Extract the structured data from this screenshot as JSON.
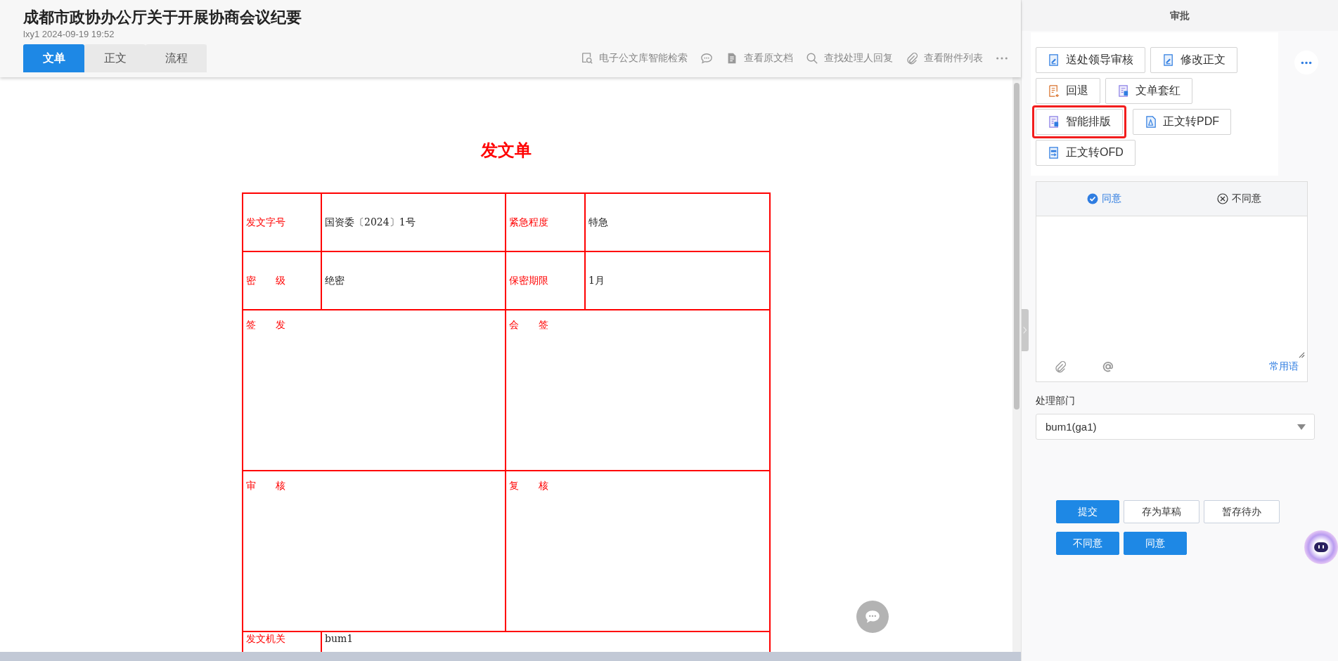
{
  "header": {
    "title": "成都市政协办公厅关于开展协商会议纪要",
    "subtitle": "lxy1 2024-09-19 19:52",
    "tabs": [
      {
        "label": "文单",
        "selected": true
      },
      {
        "label": "正文",
        "selected": false
      },
      {
        "label": "流程",
        "selected": false
      }
    ],
    "toolbar": [
      {
        "kind": "doc-search",
        "label": "电子公文库智能检索"
      },
      {
        "kind": "comment"
      },
      {
        "kind": "document",
        "label": "查看原文档"
      },
      {
        "kind": "search",
        "label": "查找处理人回复"
      },
      {
        "kind": "attach",
        "label": "查看附件列表"
      },
      {
        "kind": "more"
      }
    ]
  },
  "document": {
    "title": "发文单",
    "rows": [
      {
        "kind": "fields",
        "cells": [
          {
            "label": "发文字号",
            "value": "国资委〔2024〕1号"
          },
          {
            "label": "紧急程度",
            "value": "特急"
          }
        ]
      },
      {
        "kind": "fields",
        "cells": [
          {
            "label": "密　　级",
            "value": "绝密"
          },
          {
            "label": "保密期限",
            "value": "1月"
          }
        ]
      },
      {
        "kind": "sign",
        "cells": [
          {
            "label": "签　　发"
          },
          {
            "label": "会　　签"
          }
        ]
      },
      {
        "kind": "sign",
        "cells": [
          {
            "label": "审　　核"
          },
          {
            "label": "复　　核"
          }
        ]
      },
      {
        "kind": "wide",
        "cells": [
          {
            "label": "发文机关",
            "value": "bum1"
          }
        ]
      }
    ]
  },
  "panel": {
    "title": "审批",
    "actions": [
      {
        "kind": "edit",
        "label": "送处领导审核",
        "highlighted": false
      },
      {
        "kind": "edit",
        "label": "修改正文",
        "highlighted": false
      },
      {
        "kind": "return",
        "label": "回退",
        "highlighted": false
      },
      {
        "kind": "layout",
        "label": "文单套红",
        "highlighted": false
      },
      {
        "kind": "layout",
        "label": "智能排版",
        "highlighted": true
      },
      {
        "kind": "pdf",
        "label": "正文转PDF",
        "highlighted": false
      },
      {
        "kind": "ofd",
        "label": "正文转OFD",
        "highlighted": false
      }
    ],
    "opinion": {
      "options": [
        {
          "kind": "agree",
          "label": "同意",
          "selected": true
        },
        {
          "kind": "disagree",
          "label": "不同意",
          "selected": false
        }
      ],
      "phrases": "常用语"
    },
    "department": {
      "label": "处理部门",
      "value": "bum1(ga1)"
    },
    "buttons": [
      [
        {
          "label": "提交",
          "primary": true
        },
        {
          "label": "存为草稿",
          "primary": false
        },
        {
          "label": "暂存待办",
          "primary": false
        }
      ],
      [
        {
          "label": "不同意",
          "primary": true
        },
        {
          "label": "同意",
          "primary": true
        }
      ]
    ]
  }
}
